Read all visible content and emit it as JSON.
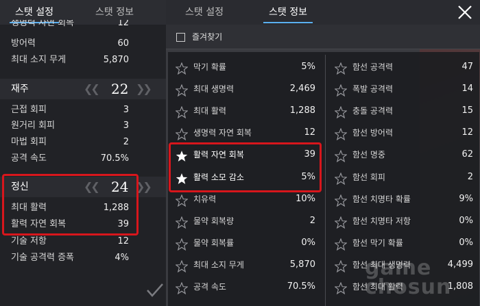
{
  "left_panel": {
    "tabs": [
      {
        "label": "스탯 설정",
        "active": true
      },
      {
        "label": "스탯 정보",
        "active": false
      }
    ],
    "cut_row": {
      "label": "생명력 자연 회복",
      "value": "12"
    },
    "rows_top": [
      {
        "label": "방어력",
        "value": "60"
      },
      {
        "label": "최대 소지 무게",
        "value": "5,870"
      }
    ],
    "group_dex": {
      "label": "재주",
      "value": "22",
      "rows": [
        {
          "label": "근접 회피",
          "value": "3"
        },
        {
          "label": "원거리 회피",
          "value": "3"
        },
        {
          "label": "마법 회피",
          "value": "2"
        },
        {
          "label": "공격 속도",
          "value": "70.5%"
        }
      ]
    },
    "group_spirit": {
      "label": "정신",
      "value": "24",
      "rows": [
        {
          "label": "최대 활력",
          "value": "1,288"
        },
        {
          "label": "활력 자연 회복",
          "value": "39"
        },
        {
          "label": "기술 저항",
          "value": "12"
        },
        {
          "label": "기술 공격력 증폭",
          "value": "4%"
        }
      ]
    }
  },
  "right_panel": {
    "tabs": [
      {
        "label": "스탯 설정",
        "active": false
      },
      {
        "label": "스탯 정보",
        "active": true
      }
    ],
    "favorites_label": "즐겨찾기",
    "left_column": [
      {
        "label": "막기 확률",
        "value": "5%",
        "favorite": false
      },
      {
        "label": "최대 생명력",
        "value": "2,469",
        "favorite": false
      },
      {
        "label": "최대 활력",
        "value": "1,288",
        "favorite": false
      },
      {
        "label": "생명력 자연 회복",
        "value": "12",
        "favorite": false
      },
      {
        "label": "활력 자연 회복",
        "value": "39",
        "favorite": true
      },
      {
        "label": "활력 소모 감소",
        "value": "5%",
        "favorite": true
      },
      {
        "label": "치유력",
        "value": "10%",
        "favorite": false
      },
      {
        "label": "물약 회복량",
        "value": "2",
        "favorite": false
      },
      {
        "label": "물약 회복률",
        "value": "0%",
        "favorite": false
      },
      {
        "label": "최대 소지 무게",
        "value": "5,870",
        "favorite": false
      },
      {
        "label": "공격 속도",
        "value": "70.5%",
        "favorite": false
      }
    ],
    "right_column": [
      {
        "label": "함선 공격력",
        "value": "47",
        "favorite": false
      },
      {
        "label": "폭발 공격력",
        "value": "14",
        "favorite": false
      },
      {
        "label": "충돌 공격력",
        "value": "15",
        "favorite": false
      },
      {
        "label": "함선 방어력",
        "value": "12",
        "favorite": false
      },
      {
        "label": "함선 명중",
        "value": "62",
        "favorite": false
      },
      {
        "label": "함선 회피",
        "value": "2",
        "favorite": false
      },
      {
        "label": "함선 치명타 확률",
        "value": "9%",
        "favorite": false
      },
      {
        "label": "함선 치명타 저항",
        "value": "0%",
        "favorite": false
      },
      {
        "label": "함선 막기 확률",
        "value": "0%",
        "favorite": false
      },
      {
        "label": "함선 최대 생명력",
        "value": "4,499",
        "favorite": false
      },
      {
        "label": "함선 최대 활력",
        "value": "1,808",
        "favorite": false
      }
    ]
  },
  "watermark": {
    "line1": "game",
    "line2": "chosun"
  },
  "colors": {
    "highlight": "#d8161c",
    "tab_underline": "#5ab0f0",
    "panel_bg": "#212226"
  },
  "icons": {
    "close": "close-icon",
    "confirm": "check-icon",
    "favorite_on": "star-filled-icon",
    "favorite_off": "star-outline-icon",
    "arrows": "double-chevron-icon"
  }
}
